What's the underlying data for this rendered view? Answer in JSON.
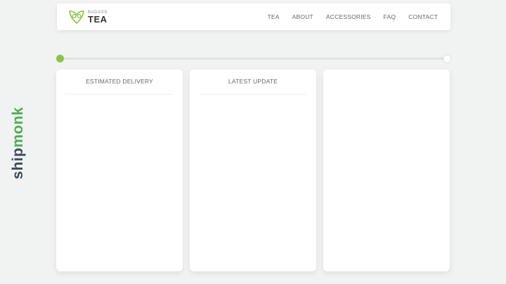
{
  "header": {
    "logo": {
      "small_text": "BADASS",
      "big_text": "TEA",
      "icon": "owl-leaf-logo-icon"
    },
    "nav": [
      "TEA",
      "ABOUT",
      "ACCESSORIES",
      "FAQ",
      "CONTACT"
    ]
  },
  "progress": {
    "fraction": 0.0
  },
  "cards": [
    {
      "title": "ESTIMATED DELIVERY"
    },
    {
      "title": "LATEST UPDATE"
    },
    {
      "title": ""
    }
  ],
  "side_brand": {
    "part1": "ship",
    "part2": "monk"
  },
  "colors": {
    "accent_green": "#8bc34a",
    "brand_green": "#4caf50",
    "brand_navy": "#3c4a5c",
    "background": "#f1f2f2"
  }
}
